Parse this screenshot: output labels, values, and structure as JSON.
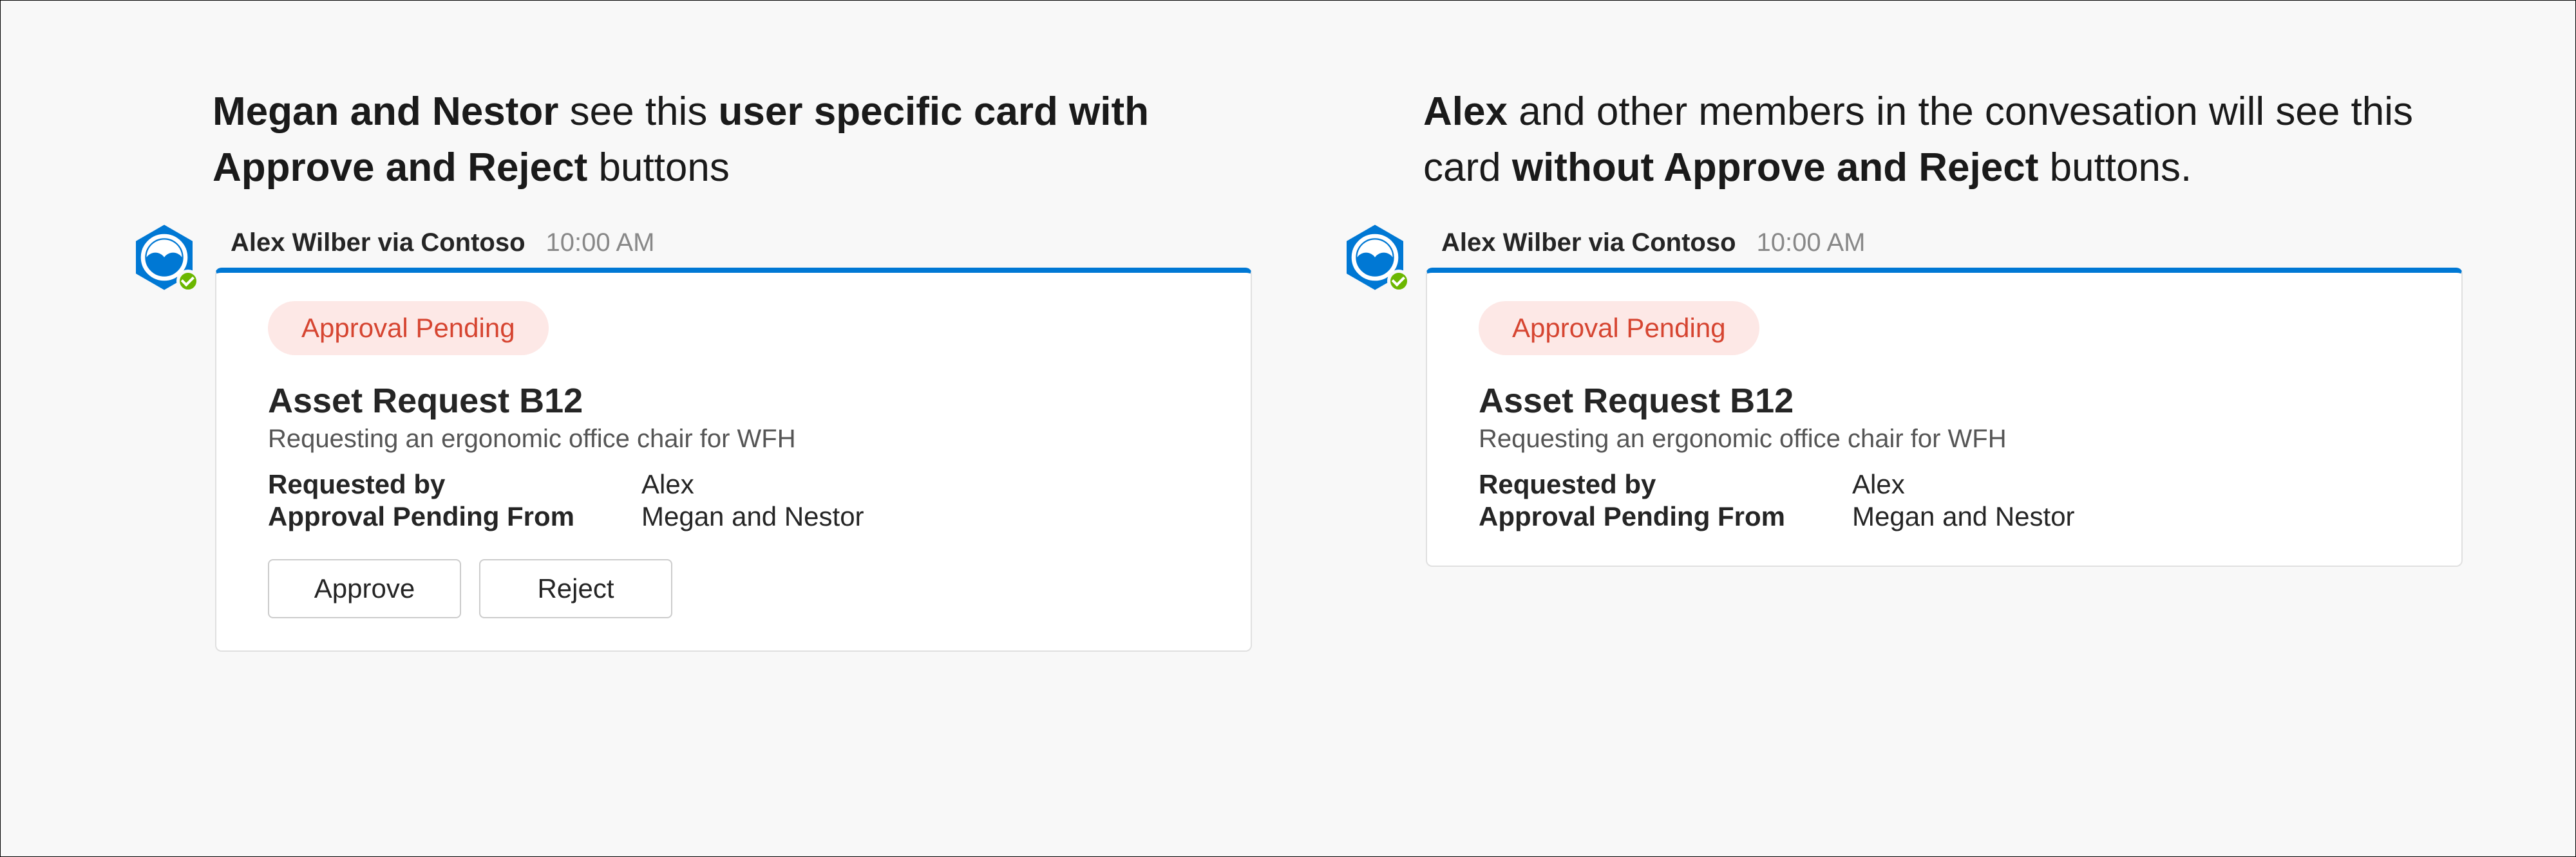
{
  "left": {
    "heading_parts": {
      "b1": "Megan and Nestor",
      "t1": " see this ",
      "b2": "user specific card with Approve and Reject",
      "t2": " buttons"
    },
    "sender": "Alex Wilber via Contoso",
    "time": "10:00 AM",
    "status": "Approval Pending",
    "title": "Asset Request B12",
    "subtitle": "Requesting an ergonomic office chair for WFH",
    "fields": {
      "requested_by_label": "Requested by",
      "requested_by_value": "Alex",
      "pending_from_label": "Approval Pending From",
      "pending_from_value": "Megan and Nestor"
    },
    "approve": "Approve",
    "reject": "Reject"
  },
  "right": {
    "heading_parts": {
      "b1": "Alex",
      "t1": " and other members in the convesation will see this card ",
      "b2": "without Approve and Reject",
      "t2": " buttons."
    },
    "sender": "Alex Wilber via Contoso",
    "time": "10:00 AM",
    "status": "Approval Pending",
    "title": "Asset Request B12",
    "subtitle": "Requesting an ergonomic office chair for WFH",
    "fields": {
      "requested_by_label": "Requested by",
      "requested_by_value": "Alex",
      "pending_from_label": "Approval Pending From",
      "pending_from_value": "Megan and Nestor"
    }
  }
}
